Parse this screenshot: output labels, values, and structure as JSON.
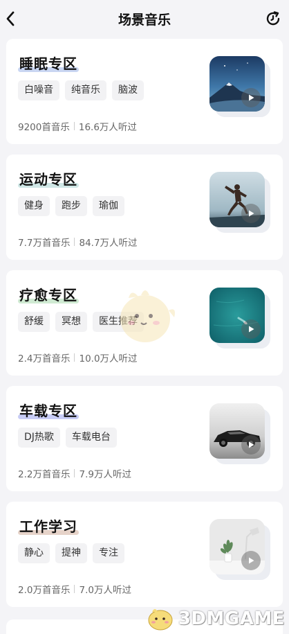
{
  "header": {
    "title": "场景音乐",
    "back_icon": "chevron-left-icon",
    "refresh_icon": "refresh-icon"
  },
  "cards": [
    {
      "title": "睡眠专区",
      "underline_color": "#c9d6f2",
      "tags": [
        "白噪音",
        "纯音乐",
        "脑波"
      ],
      "count": "9200首音乐",
      "listeners": "16.6万人听过",
      "thumb": "mountain-night"
    },
    {
      "title": "运动专区",
      "underline_color": "#cfe7e6",
      "tags": [
        "健身",
        "跑步",
        "瑜伽"
      ],
      "count": "7.7万首音乐",
      "listeners": "84.7万人听过",
      "thumb": "runner"
    },
    {
      "title": "疗愈专区",
      "underline_color": "#cfead2",
      "tags": [
        "舒缓",
        "冥想",
        "医生推荐"
      ],
      "count": "2.4万首音乐",
      "listeners": "10.0万人听过",
      "thumb": "ocean-boat"
    },
    {
      "title": "车载专区",
      "underline_color": "#c7ccf5",
      "tags": [
        "DJ热歌",
        "车载电台"
      ],
      "count": "2.2万首音乐",
      "listeners": "7.9万人听过",
      "thumb": "car"
    },
    {
      "title": "工作学习",
      "underline_color": "#e6d3c9",
      "tags": [
        "静心",
        "提神",
        "专注"
      ],
      "count": "2.0万首音乐",
      "listeners": "7.0万人听过",
      "thumb": "desk-plant"
    }
  ],
  "watermark": {
    "text": "3DMGAME"
  }
}
